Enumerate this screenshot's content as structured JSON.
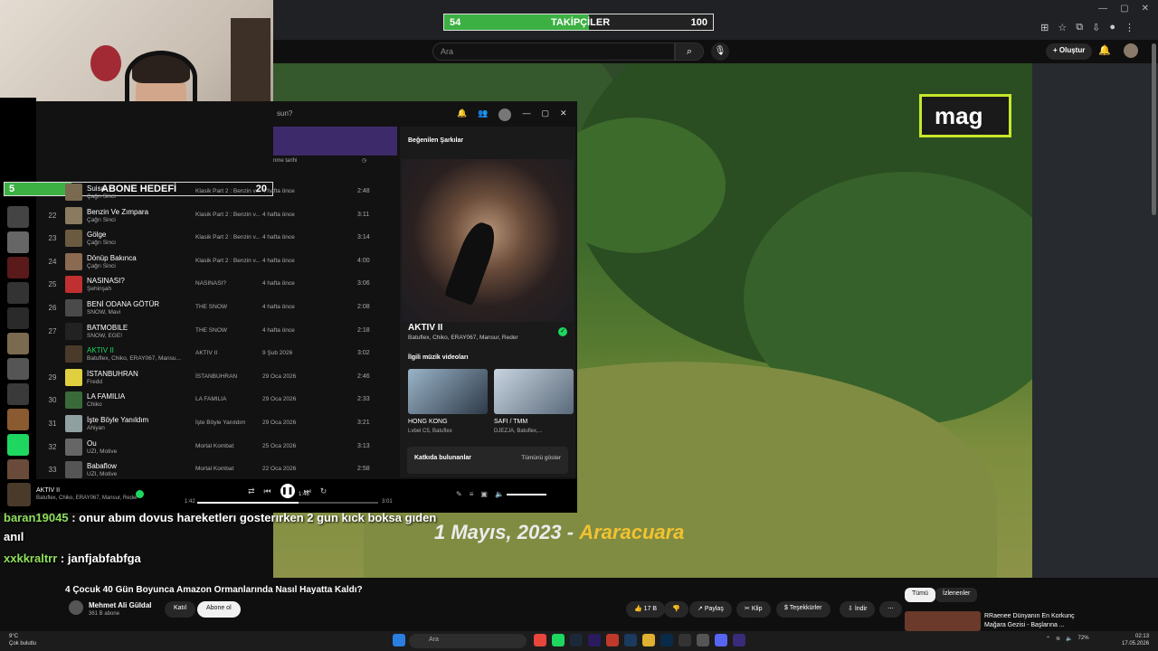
{
  "overlay": {
    "followers": {
      "label": "TAKİPÇİLER",
      "current": "54",
      "goal": "100",
      "progress": 0.54
    },
    "subs_goal": {
      "label": "ABONE HEDEFİ",
      "current": "5",
      "goal": "20",
      "progress": 0.25
    },
    "video_caption_date": "1 Mayıs, 2023 -",
    "video_caption_place": "Araracuara",
    "mag_label": "mag"
  },
  "youtube": {
    "search_placeholder": "Ara",
    "create_label": "+ Oluştur",
    "video_title": "4 Çocuk 40 Gün Boyunca Amazon Ormanlarında Nasıl Hayatta Kaldı?",
    "channel_name": "Mehmet Ali Güldal",
    "channel_subs": "361 B abone",
    "join_label": "Katıl",
    "subscribe_label": "Abone ol",
    "likes": "17 B",
    "share": "Paylaş",
    "clip": "Klip",
    "thanks": "Teşekkürler",
    "download": "İndir",
    "more": "⋯",
    "chips": [
      "Tümü",
      "İzlenenler"
    ],
    "rec_title": "RRaenee Dünyanın En Korkunç Mağara Gezisi - Başlarına ..."
  },
  "spotify": {
    "search_fragment": "sun?",
    "col_date_header": "nme tarihi",
    "playlist_title": "Beğenilen Şarkılar",
    "rows": [
      {
        "n": "",
        "title": "Suisa",
        "artist": "Çağrı Sinci",
        "album": "Klasik Part 2 : Benzin v...",
        "date": "4 hafta önce",
        "dur": "2:48"
      },
      {
        "n": "22",
        "title": "Benzin Ve Zımpara",
        "artist": "Çağrı Sinci",
        "album": "Klasik Part 2 : Benzin v...",
        "date": "4 hafta önce",
        "dur": "3:11"
      },
      {
        "n": "23",
        "title": "Gölge",
        "artist": "Çağrı Sinci",
        "album": "Klasik Part 2 : Benzin v...",
        "date": "4 hafta önce",
        "dur": "3:14"
      },
      {
        "n": "24",
        "title": "Dönüp Bakınca",
        "artist": "Çağrı Sinci",
        "album": "Klasik Part 2 : Benzin v...",
        "date": "4 hafta önce",
        "dur": "4:00"
      },
      {
        "n": "25",
        "title": "NASINASI?",
        "artist": "Şehinşah",
        "album": "NASINASI?",
        "date": "4 hafta önce",
        "dur": "3:06"
      },
      {
        "n": "26",
        "title": "BENİ ODANA GÖTÜR",
        "artist": "SNOW, Mavi",
        "album": "THE SNOW",
        "date": "4 hafta önce",
        "dur": "2:08"
      },
      {
        "n": "27",
        "title": "BATMOBILE",
        "artist": "SNOW, EGE!",
        "album": "THE SNOW",
        "date": "4 hafta önce",
        "dur": "2:18"
      },
      {
        "n": "",
        "title": "AKTIV II",
        "artist": "Batuflex, Chiko, ERAY067, Mansu...",
        "album": "AKTIV II",
        "date": "9 Şub 2026",
        "dur": "3:02"
      },
      {
        "n": "29",
        "title": "İSTANBUHRAN",
        "artist": "Fredd",
        "album": "İSTANBUHRAN",
        "date": "29 Oca 2026",
        "dur": "2:46"
      },
      {
        "n": "30",
        "title": "LA FAMILIA",
        "artist": "Chiko",
        "album": "LA FAMILIA",
        "date": "29 Oca 2026",
        "dur": "2:33"
      },
      {
        "n": "31",
        "title": "İşte Böyle Yanıldım",
        "artist": "Ahiyan",
        "album": "İşte Böyle Yanıldım",
        "date": "29 Oca 2026",
        "dur": "3:21"
      },
      {
        "n": "32",
        "title": "Ou",
        "artist": "UZI, Motive",
        "album": "Mortal Kombat",
        "date": "25 Oca 2026",
        "dur": "3:13"
      },
      {
        "n": "33",
        "title": "Babaflow",
        "artist": "UZI, Motive",
        "album": "Mortal Kombat",
        "date": "22 Oca 2026",
        "dur": "2:58"
      }
    ],
    "now_playing": {
      "title": "AKTIV II",
      "artists": "Batuflex, Chiko, ERAY067, Mansur, Reder",
      "related_videos_title": "İlgili müzik videoları",
      "videos": [
        {
          "title": "HONG KONG",
          "sub": "Lvbel C5, Batuflex"
        },
        {
          "title": "SAFI / TMM",
          "sub": "DJEZJA, Batuflex,..."
        }
      ],
      "credits_title": "Katkıda bulunanlar",
      "credits_more": "Tümünü göster"
    },
    "player": {
      "title": "AKTIV II",
      "artists": "Batuflex, Chiko, ERAY067, Mansur, Reder",
      "elapsed": "1:42",
      "total": "3:01",
      "hover_time": "1:46",
      "progress": 0.56
    }
  },
  "chat": [
    {
      "user": "baran19045",
      "text": ": onur abım dovus hareketlerı gosterırken 2 gun kıck boksa gıden"
    },
    {
      "user": "",
      "text": "anıl"
    },
    {
      "user": "xxkkraltrr",
      "text": ": janfjabfabfga"
    }
  ],
  "taskbar": {
    "weather_temp": "9°C",
    "weather_desc": "Çok bulutlu",
    "search": "Ara",
    "battery": "72%",
    "time": "02:13",
    "date": "17.05.2026"
  },
  "colors": {
    "accent_green": "#3cb043",
    "spotify_green": "#1ed760",
    "caption_gold": "#f2c230",
    "mag_border": "#c6e82a"
  }
}
